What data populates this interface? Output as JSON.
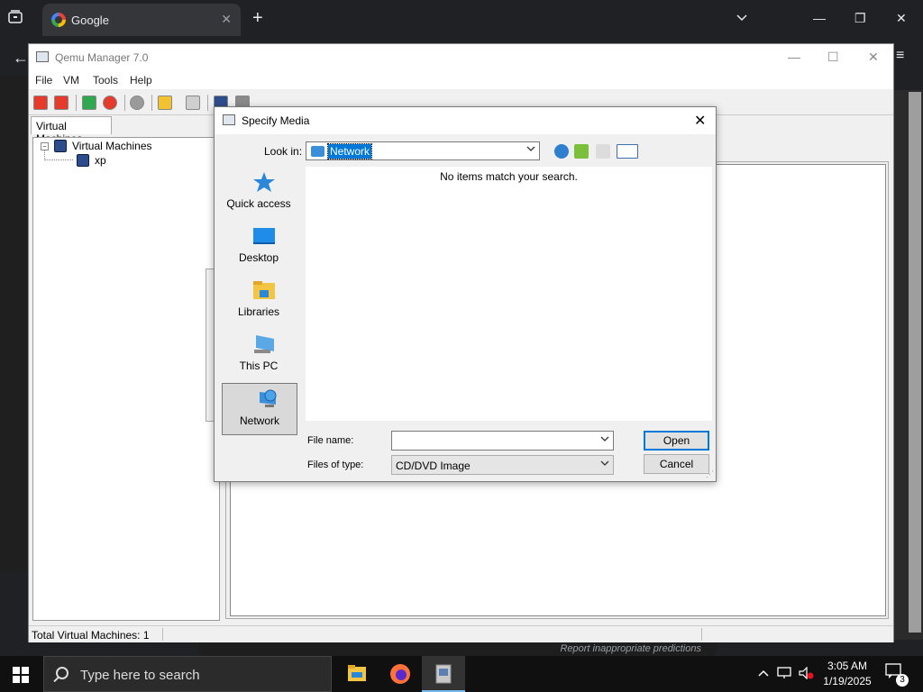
{
  "browser": {
    "tab_title": "Google",
    "tab_close": "✕",
    "new_tab": "+",
    "tab_list": "⌄",
    "minimize": "—",
    "restore": "❐",
    "close": "✕",
    "back": "←",
    "menu": "≡",
    "report_link": "Report inappropriate predictions"
  },
  "qemu": {
    "title": "Qemu Manager 7.0",
    "menus": [
      "File",
      "VM",
      "Tools",
      "Help"
    ],
    "window_controls": {
      "minimize": "—",
      "maximize": "☐",
      "close": "✕"
    },
    "toolbar_icons": [
      "add-vm-icon",
      "remove-vm-icon",
      "start-vm-icon",
      "stop-vm-icon",
      "network-icon",
      "open-folder-icon",
      "settings-tools-icon",
      "save-icon",
      "grid-icon"
    ],
    "panel_tab": "Virtual Machines",
    "tree": {
      "root": "Virtual Machines",
      "root_toggle": "−",
      "children": [
        "xp"
      ]
    },
    "status": "Total Virtual Machines: 1"
  },
  "dialog": {
    "title": "Specify Media",
    "close": "✕",
    "look_in_label": "Look in:",
    "look_in_value": "Network",
    "empty_message": "No items match your search.",
    "places": [
      {
        "label": "Quick access",
        "icon": "star-icon"
      },
      {
        "label": "Desktop",
        "icon": "desktop-icon"
      },
      {
        "label": "Libraries",
        "icon": "libraries-icon"
      },
      {
        "label": "This PC",
        "icon": "computer-icon"
      },
      {
        "label": "Network",
        "icon": "network-icon",
        "selected": true
      }
    ],
    "file_name_label": "File name:",
    "file_name_value": "",
    "files_of_type_label": "Files of type:",
    "files_of_type_value": "CD/DVD Image",
    "open_button": "Open",
    "cancel_button": "Cancel"
  },
  "taskbar": {
    "search_placeholder": "Type here to search",
    "time": "3:05 AM",
    "date": "1/19/2025",
    "notification_count": "3"
  },
  "colors": {
    "selection_blue": "#0078d7",
    "taskbar_bg": "#101010",
    "browser_bg": "#202124"
  }
}
